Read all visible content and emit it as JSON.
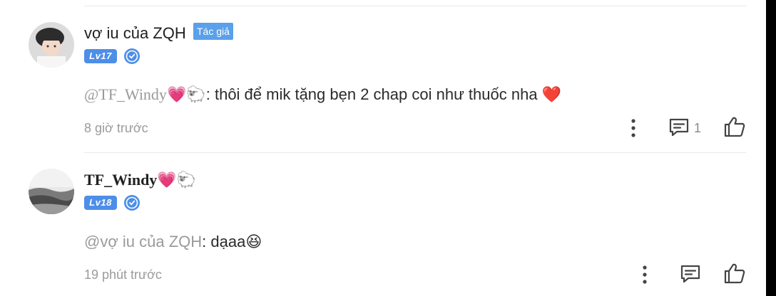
{
  "comments": [
    {
      "username": "vợ iu của ZQH",
      "author_tag": "Tác giả",
      "level": "Lv17",
      "mention": "@TF_Windy",
      "mention_emoji": "💗🐑",
      "text_sep": ": ",
      "text": "thôi để mik tặng bẹn 2 chap coi như thuốc nha",
      "text_emoji": "❤️",
      "time": "8 giờ trước",
      "reply_count": "1"
    },
    {
      "username": "TF_Windy",
      "username_emoji": "💗🐑",
      "level": "Lv18",
      "mention": "@vợ iu của ZQH",
      "text_sep": ": ",
      "text": "dạaa",
      "text_emoji": "😆",
      "time": "19 phút trước"
    }
  ],
  "colors": {
    "accent_blue": "#4d8ee8",
    "author_tag_bg": "#5aa0ea",
    "muted_text": "#9b9b9b",
    "heart": "#f0405a"
  },
  "icons": [
    "more-vertical-icon",
    "reply-comment-icon",
    "thumbs-up-icon",
    "verified-icon"
  ]
}
